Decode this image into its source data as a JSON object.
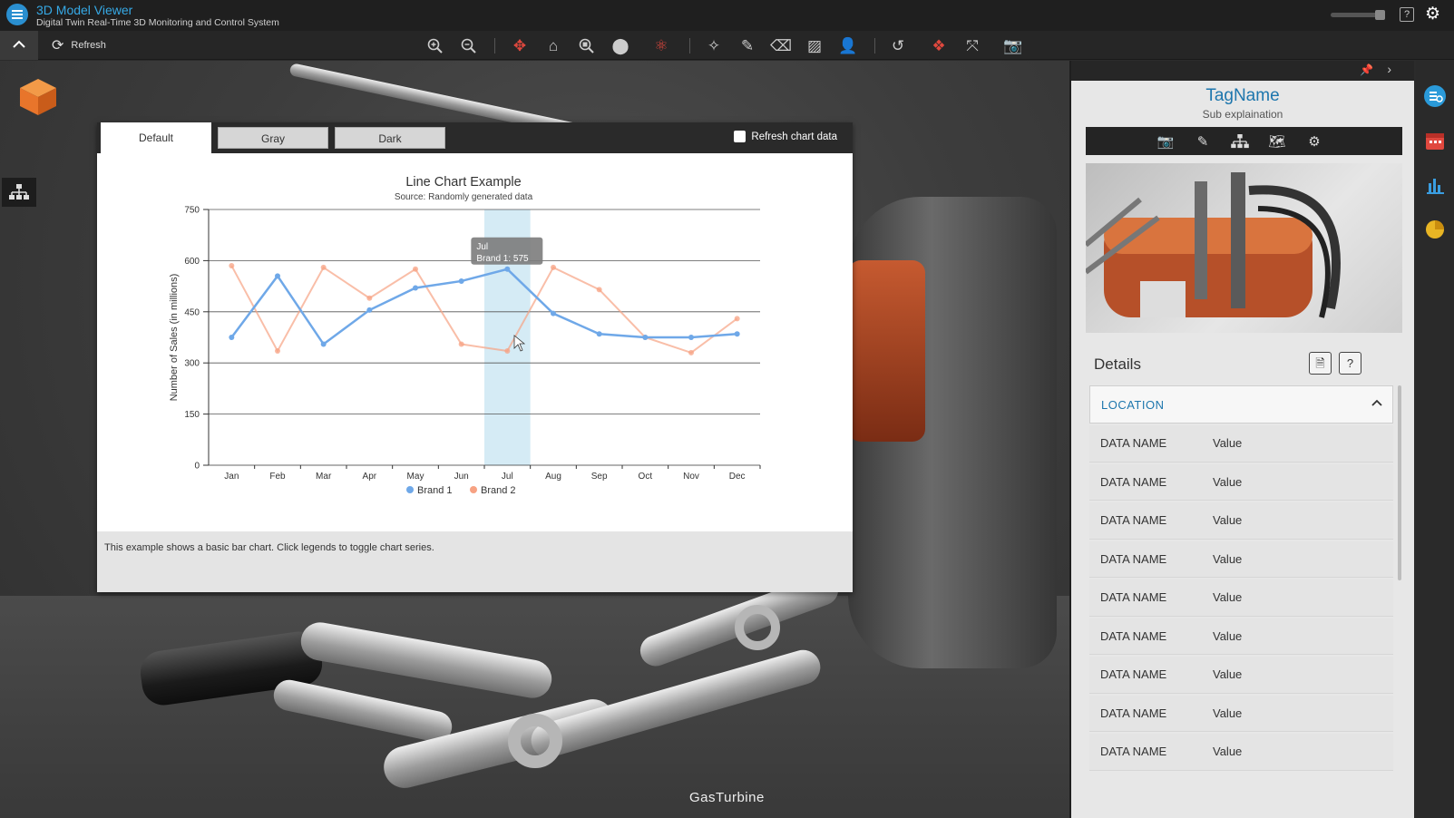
{
  "app": {
    "title": "3D Model Viewer",
    "subtitle": "Digital Twin Real-Time 3D Monitoring and Control System"
  },
  "toolbar": {
    "refresh_label": "Refresh",
    "tools": [
      "zoom-in",
      "zoom-out",
      "orbit",
      "camera-home",
      "zoom-fit",
      "record",
      "explode",
      "magic-wand",
      "highlighter",
      "eraser",
      "section-box",
      "person",
      "reset",
      "move-parts",
      "fullscreen",
      "screenshot"
    ]
  },
  "viewport": {
    "model_label": "GasTurbine"
  },
  "chart_popup": {
    "tabs": [
      "Default",
      "Gray",
      "Dark"
    ],
    "active_tab": "Default",
    "refresh_checkbox_label": "Refresh chart data",
    "refresh_checked": false,
    "description": "This example shows a basic bar chart. Click legends to toggle chart series.",
    "tooltip": {
      "title": "Jul",
      "text": "Brand 1: 575"
    }
  },
  "chart_data": {
    "type": "line",
    "title": "Line Chart Example",
    "subtitle": "Source: Randomly generated data",
    "xlabel": "",
    "ylabel": "Number of Sales (in millions)",
    "categories": [
      "Jan",
      "Feb",
      "Mar",
      "Apr",
      "May",
      "Jun",
      "Jul",
      "Aug",
      "Sep",
      "Oct",
      "Nov",
      "Dec"
    ],
    "ylim": [
      0,
      750
    ],
    "yticks": [
      0,
      150,
      300,
      450,
      600,
      750
    ],
    "grid": true,
    "legend": "bottom",
    "highlight_category": "Jul",
    "series": [
      {
        "name": "Brand 1",
        "color": "#6fa8e8",
        "values": [
          375,
          555,
          355,
          455,
          520,
          540,
          575,
          445,
          385,
          375,
          375,
          385
        ]
      },
      {
        "name": "Brand 2",
        "color": "#f7a283",
        "values": [
          585,
          335,
          580,
          490,
          575,
          355,
          335,
          580,
          515,
          375,
          330,
          430
        ]
      }
    ]
  },
  "right_panel": {
    "tag_name": "TagName",
    "sub_explanation": "Sub explaination",
    "details_title": "Details",
    "section_title": "LOCATION",
    "rows": [
      {
        "name": "DATA NAME",
        "value": "Value"
      },
      {
        "name": "DATA NAME",
        "value": "Value"
      },
      {
        "name": "DATA NAME",
        "value": "Value"
      },
      {
        "name": "DATA NAME",
        "value": "Value"
      },
      {
        "name": "DATA NAME",
        "value": "Value"
      },
      {
        "name": "DATA NAME",
        "value": "Value"
      },
      {
        "name": "DATA NAME",
        "value": "Value"
      },
      {
        "name": "DATA NAME",
        "value": "Value"
      },
      {
        "name": "DATA NAME",
        "value": "Value"
      }
    ]
  },
  "colors": {
    "accent": "#36a9e6",
    "tag": "#1d76ad",
    "model_orange": "#e8752b"
  }
}
